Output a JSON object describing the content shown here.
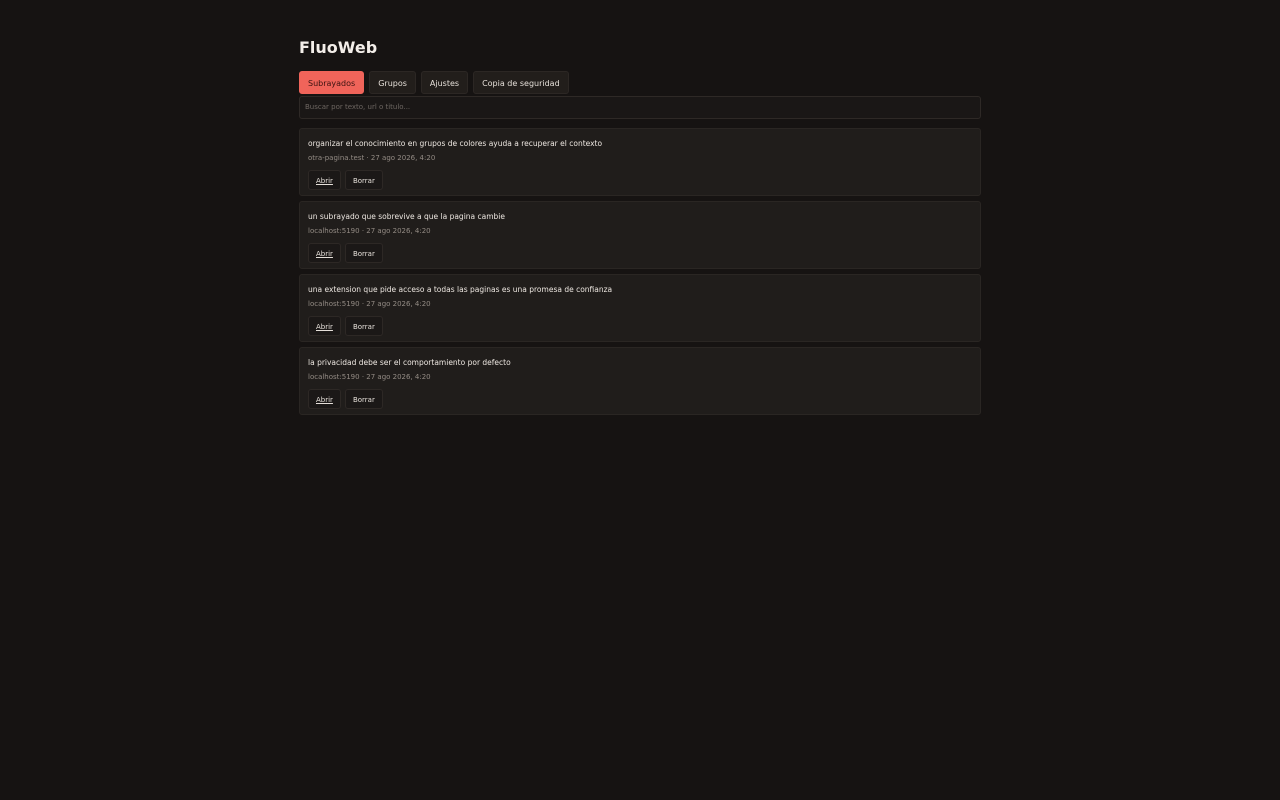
{
  "app": {
    "title": "FluoWeb"
  },
  "tabs": [
    {
      "label": "Subrayados",
      "active": true
    },
    {
      "label": "Grupos",
      "active": false
    },
    {
      "label": "Ajustes",
      "active": false
    },
    {
      "label": "Copia de seguridad",
      "active": false
    }
  ],
  "search": {
    "placeholder": "Buscar por texto, url o titulo...",
    "value": ""
  },
  "highlights": [
    {
      "text": "organizar el conocimiento en grupos de colores ayuda a recuperar el contexto",
      "meta": "otra-pagina.test · 27 ago 2026, 4:20",
      "open_label": "Abrir",
      "delete_label": "Borrar"
    },
    {
      "text": "un subrayado que sobrevive a que la pagina cambie",
      "meta": "localhost:5190 · 27 ago 2026, 4:20",
      "open_label": "Abrir",
      "delete_label": "Borrar"
    },
    {
      "text": "una extension que pide acceso a todas las paginas es una promesa de confianza",
      "meta": "localhost:5190 · 27 ago 2026, 4:20",
      "open_label": "Abrir",
      "delete_label": "Borrar"
    },
    {
      "text": "la privacidad debe ser el comportamiento por defecto",
      "meta": "localhost:5190 · 27 ago 2026, 4:20",
      "open_label": "Abrir",
      "delete_label": "Borrar"
    }
  ],
  "colors": {
    "background": "#161312",
    "accent": "#f0645a",
    "card": "#201d1b"
  }
}
